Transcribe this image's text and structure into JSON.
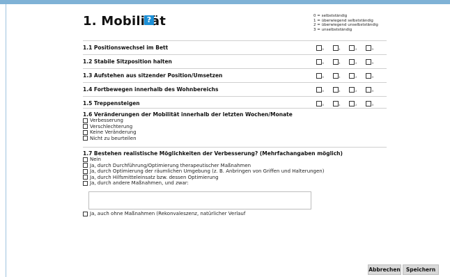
{
  "title": "1. Mobilität",
  "help_label": "?",
  "legend": [
    "0 = selbstständig",
    "1 = überwiegend selbstständig",
    "2 = überwiegend unselbstständig",
    "3 = unselbstständig"
  ],
  "items": [
    {
      "label": "1.1 Positionswechsel im Bett",
      "options": [
        "0",
        "1",
        "2",
        "3"
      ]
    },
    {
      "label": "1.2 Stabile Sitzposition halten",
      "options": [
        "0",
        "1",
        "2",
        "3"
      ]
    },
    {
      "label": "1.3 Aufstehen aus sitzender Position/Umsetzen",
      "options": [
        "0",
        "1",
        "2",
        "3"
      ]
    },
    {
      "label": "1.4 Fortbewegen innerhalb des Wohnbereichs",
      "options": [
        "0",
        "1",
        "2",
        "3"
      ]
    },
    {
      "label": "1.5 Treppensteigen",
      "options": [
        "0",
        "1",
        "2",
        "3"
      ]
    }
  ],
  "section6": {
    "title": "1.6 Veränderungen der Mobilität innerhalb der letzten Wochen/Monate",
    "options": [
      "Verbesserung",
      "Verschlechterung",
      "Keine Veränderung",
      "Nicht zu beurteilen"
    ]
  },
  "section7": {
    "title": "1.7 Bestehen realistische Möglichkeiten der Verbesserung? (Mehrfachangaben möglich)",
    "options": [
      "Nein",
      "Ja, durch Durchführung/Optimierung therapeutischer Maßnahmen",
      "Ja, durch Optimierung der räumlichen Umgebung (z. B. Anbringen von Griffen und Halterungen)",
      "Ja, durch Hilfsmitteleinsatz bzw. dessen Optimierung",
      "Ja, durch andere Maßnahmen, und zwar:"
    ],
    "last_option": "Ja, auch ohne Maßnahmen (Rekonvaleszenz, natürlicher Verlauf"
  },
  "buttons": {
    "cancel": "Abbrechen",
    "save": "Speichern"
  }
}
